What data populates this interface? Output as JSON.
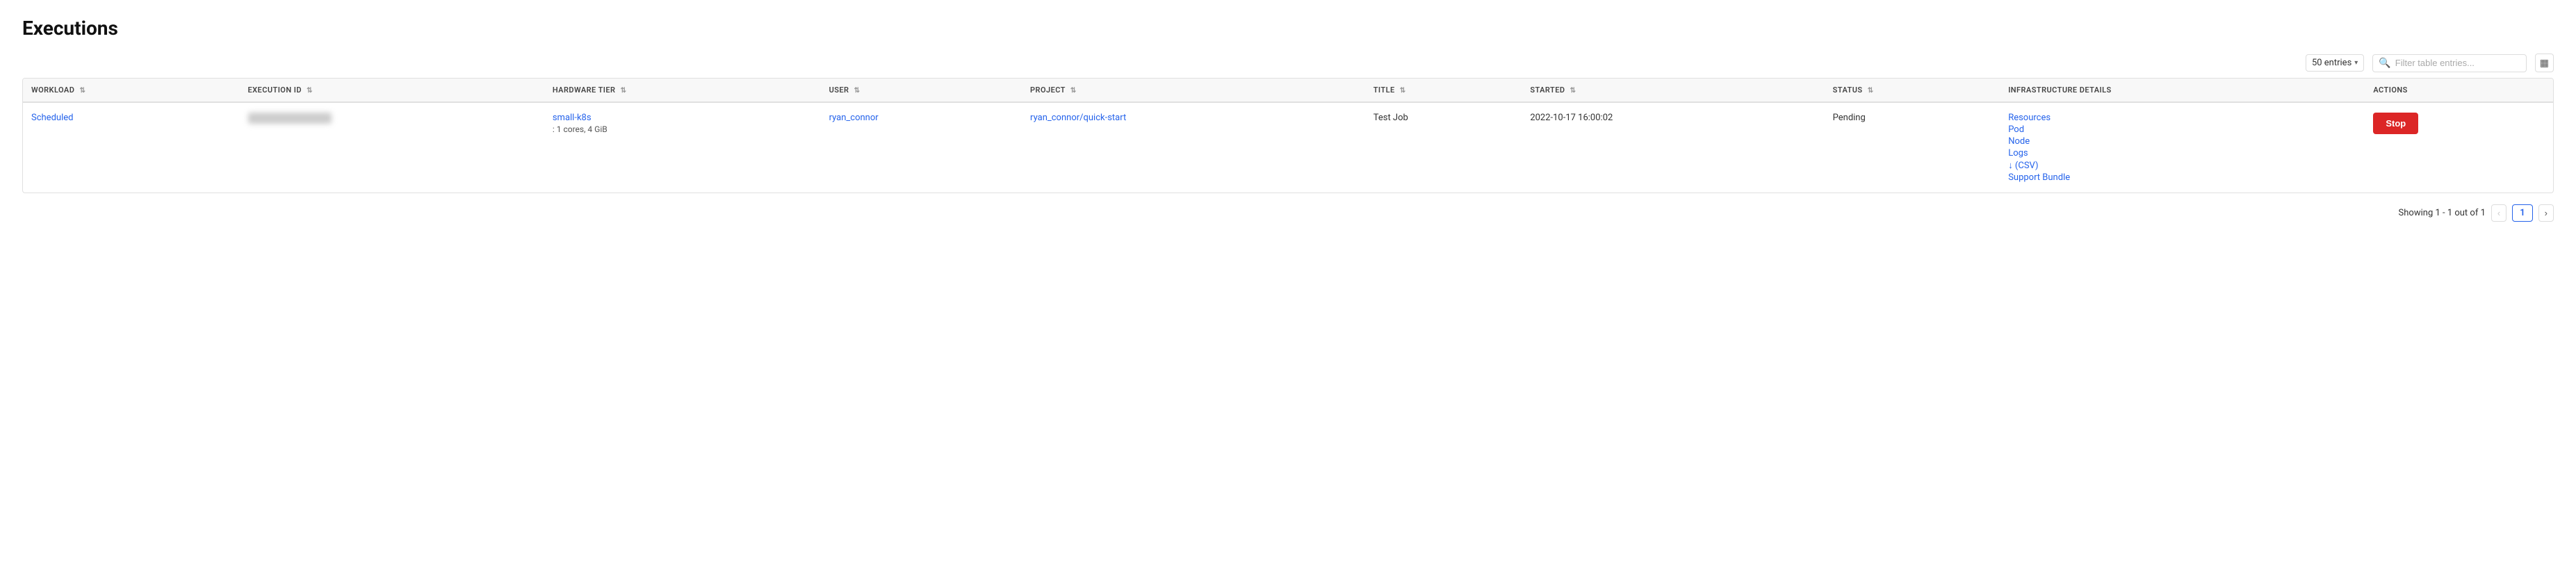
{
  "page": {
    "title": "Executions"
  },
  "toolbar": {
    "entries_label": "50 entries",
    "entries_chevron": "▾",
    "search_placeholder": "Filter table entries...",
    "col_settings_icon": "⊞"
  },
  "table": {
    "columns": [
      {
        "id": "workload",
        "label": "WORKLOAD"
      },
      {
        "id": "execution_id",
        "label": "EXECUTION ID"
      },
      {
        "id": "hardware_tier",
        "label": "HARDWARE TIER"
      },
      {
        "id": "user",
        "label": "USER"
      },
      {
        "id": "project",
        "label": "PROJECT"
      },
      {
        "id": "title",
        "label": "TITLE"
      },
      {
        "id": "started",
        "label": "STARTED"
      },
      {
        "id": "status",
        "label": "STATUS"
      },
      {
        "id": "infra_details",
        "label": "INFRASTRUCTURE DETAILS"
      },
      {
        "id": "actions",
        "label": "ACTIONS"
      }
    ],
    "rows": [
      {
        "workload": "Scheduled",
        "execution_id": "BLURRED",
        "hardware_tier_name": "small-k8s",
        "hardware_tier_spec": ": 1 cores, 4 GiB",
        "user": "ryan_connor",
        "project": "ryan_connor/quick-start",
        "title": "Test Job",
        "started": "2022-10-17 16:00:02",
        "status": "Pending",
        "infra_links": [
          {
            "label": "Resources",
            "href": "#"
          },
          {
            "label": "Pod",
            "href": "#"
          },
          {
            "label": "Node",
            "href": "#"
          },
          {
            "label": "Logs",
            "href": "#"
          },
          {
            "label": "↓ (CSV)",
            "href": "#"
          },
          {
            "label": "Support Bundle",
            "href": "#"
          }
        ],
        "action_label": "Stop"
      }
    ]
  },
  "pagination": {
    "summary": "Showing 1 - 1 out of 1",
    "prev_label": "‹",
    "page_number": "1",
    "next_label": "›"
  }
}
